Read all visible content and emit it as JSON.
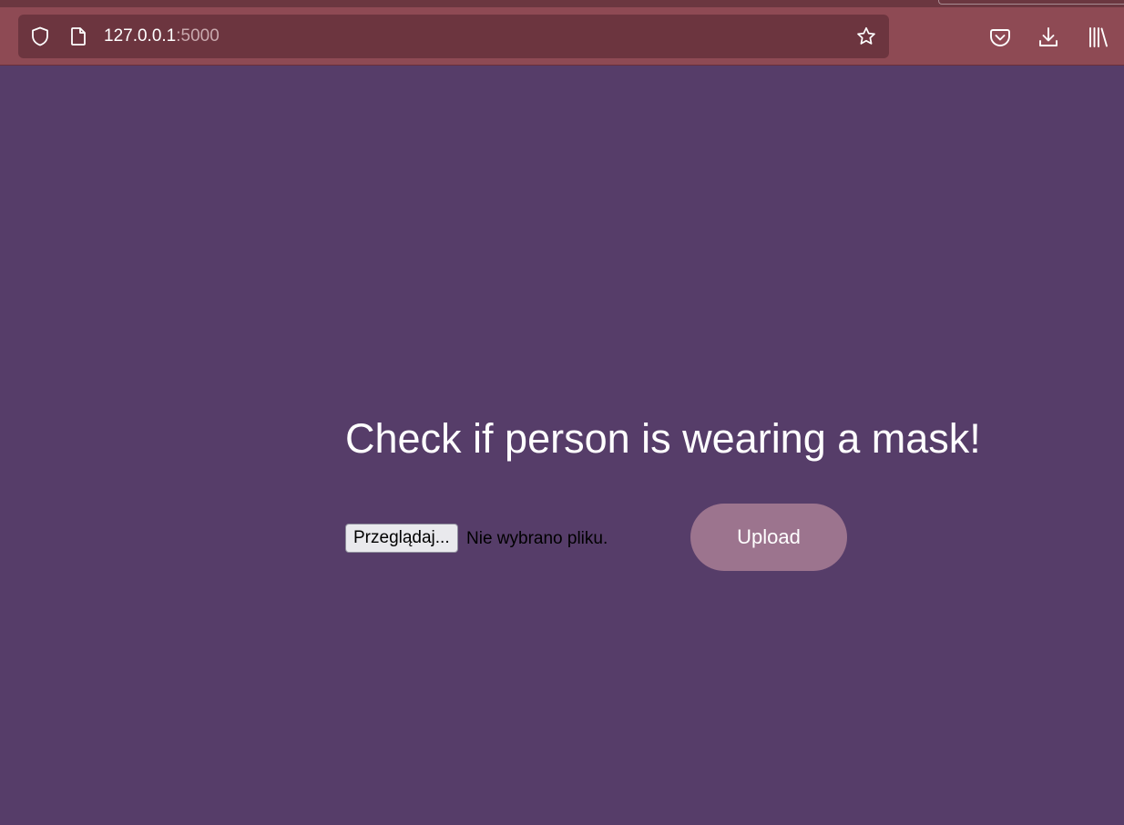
{
  "browser": {
    "url_host": "127.0.0.1",
    "url_port": ":5000",
    "icons": {
      "shield": "shield-icon",
      "page": "page-icon",
      "bookmark": "star-icon",
      "pocket": "pocket-icon",
      "downloads": "download-icon",
      "library": "library-icon"
    }
  },
  "page": {
    "title": "Check if person is wearing a mask!",
    "file_input": {
      "button_label": "Przeglądaj...",
      "status": "Nie wybrano pliku."
    },
    "upload_label": "Upload"
  },
  "colors": {
    "page_background": "#563d69",
    "toolbar_background": "#8e4a54",
    "urlbar_background": "#6c353f",
    "upload_button": "#9c748e",
    "title_text": "#ffffff"
  }
}
